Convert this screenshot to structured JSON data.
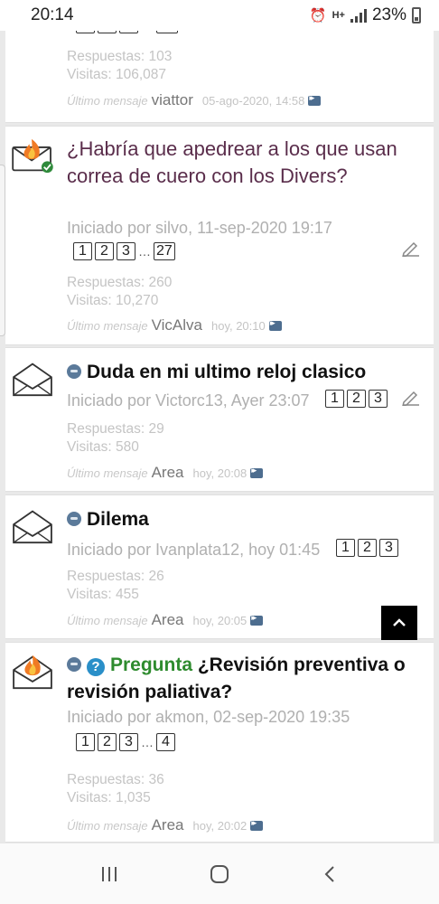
{
  "status_bar": {
    "time": "20:14",
    "battery": "23%",
    "network": "H+"
  },
  "threads": [
    {
      "replies": "Respuestas: 103",
      "visits": "Visitas: 106,087",
      "last_label": "Último mensaje",
      "last_user": "viattor",
      "last_time": "05-ago-2020, 14:58"
    },
    {
      "title": "¿Habría que apedrear a los que usan correa de cuero con los Divers?",
      "started": "Iniciado por silvo, 11-sep-2020 19:17",
      "pages": [
        "1",
        "2",
        "3",
        "27"
      ],
      "replies": "Respuestas: 260",
      "visits": "Visitas: 10,270",
      "last_label": "Último mensaje",
      "last_user": "VicAlva",
      "last_time": "hoy, 20:10"
    },
    {
      "title": "Duda en mi ultimo reloj clasico",
      "started": "Iniciado por Victorc13, Ayer 23:07",
      "pages": [
        "1",
        "2",
        "3"
      ],
      "replies": "Respuestas: 29",
      "visits": "Visitas: 580",
      "last_label": "Último mensaje",
      "last_user": "Area",
      "last_time": "hoy, 20:08"
    },
    {
      "title": "Dilema",
      "started": "Iniciado por Ivanplata12, hoy 01:45",
      "pages": [
        "1",
        "2",
        "3"
      ],
      "replies": "Respuestas: 26",
      "visits": "Visitas: 455",
      "last_label": "Último mensaje",
      "last_user": "Area",
      "last_time": "hoy, 20:05"
    },
    {
      "prefix": "Pregunta",
      "title": "¿Revisión preventiva o revisión paliativa?",
      "started": "Iniciado por akmon, 02-sep-2020 19:35",
      "pages": [
        "1",
        "2",
        "3",
        "4"
      ],
      "replies": "Respuestas: 36",
      "visits": "Visitas: 1,035",
      "last_label": "Último mensaje",
      "last_user": "Area",
      "last_time": "hoy, 20:02"
    }
  ],
  "icons": {
    "hot_topic": "hot-topic-envelope-icon",
    "read_topic": "envelope-icon",
    "edit": "pencil-icon",
    "goto_last": "goto-last-post-icon",
    "scroll_top": "chevron-up-icon"
  },
  "colors": {
    "accent": "#5b7a9a",
    "prefix_green": "#2e8b2e",
    "title_plum": "#5a2d4b"
  }
}
